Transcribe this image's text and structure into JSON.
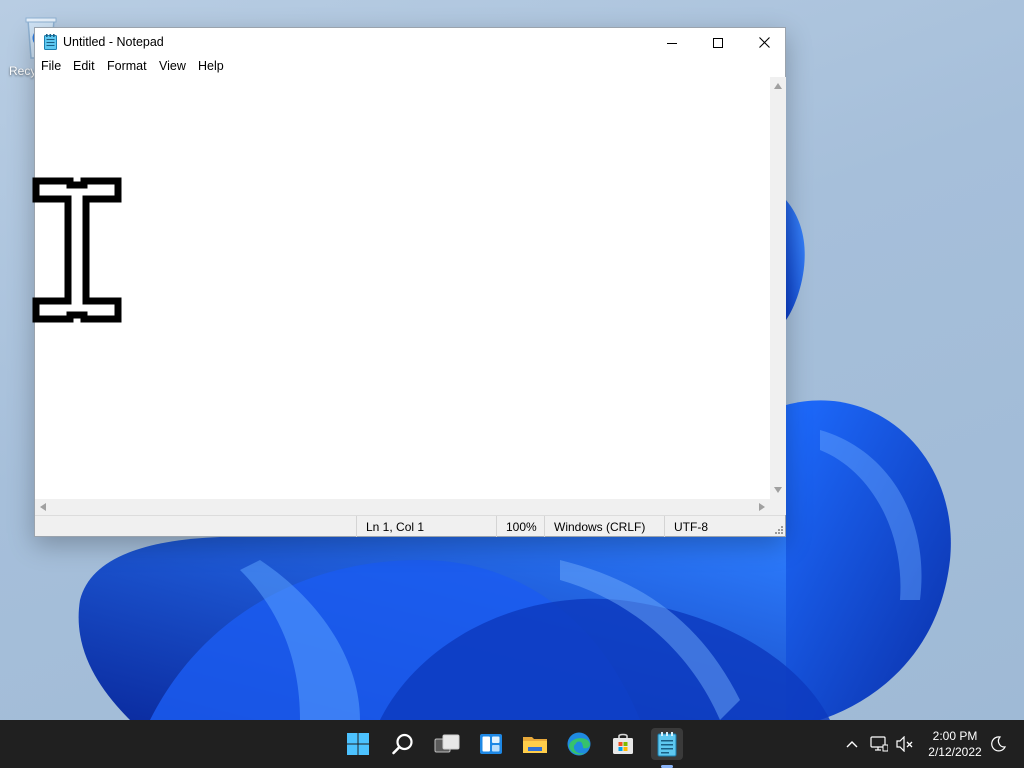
{
  "desktop": {
    "icons": [
      {
        "label": "Recy",
        "icon": "recycle-bin-icon"
      }
    ]
  },
  "notepad": {
    "title": "Untitled - Notepad",
    "icon": "notepad-icon",
    "controls": {
      "minimize": "minimize-icon",
      "maximize": "maximize-icon",
      "close": "close-icon"
    },
    "menu": [
      "File",
      "Edit",
      "Format",
      "View",
      "Help"
    ],
    "document_text": "",
    "status": {
      "position": "Ln 1, Col 1",
      "zoom": "100%",
      "line_ending": "Windows (CRLF)",
      "encoding": "UTF-8"
    }
  },
  "cursor": {
    "type": "i-beam-cursor-icon"
  },
  "taskbar": {
    "apps": [
      {
        "name": "start-icon"
      },
      {
        "name": "search-icon"
      },
      {
        "name": "task-view-icon"
      },
      {
        "name": "widgets-icon"
      },
      {
        "name": "file-explorer-icon"
      },
      {
        "name": "edge-icon"
      },
      {
        "name": "store-icon"
      },
      {
        "name": "notepad-icon",
        "active": true
      }
    ],
    "tray": {
      "icons": [
        "chevron-up-icon",
        "network-icon",
        "volume-muted-icon",
        "night-light-icon"
      ],
      "time": "2:00 PM",
      "date": "2/12/2022"
    }
  },
  "colors": {
    "accent": "#0067c0",
    "taskbar": "#202020",
    "wallpaper_bloom": "#0a4fd9"
  }
}
